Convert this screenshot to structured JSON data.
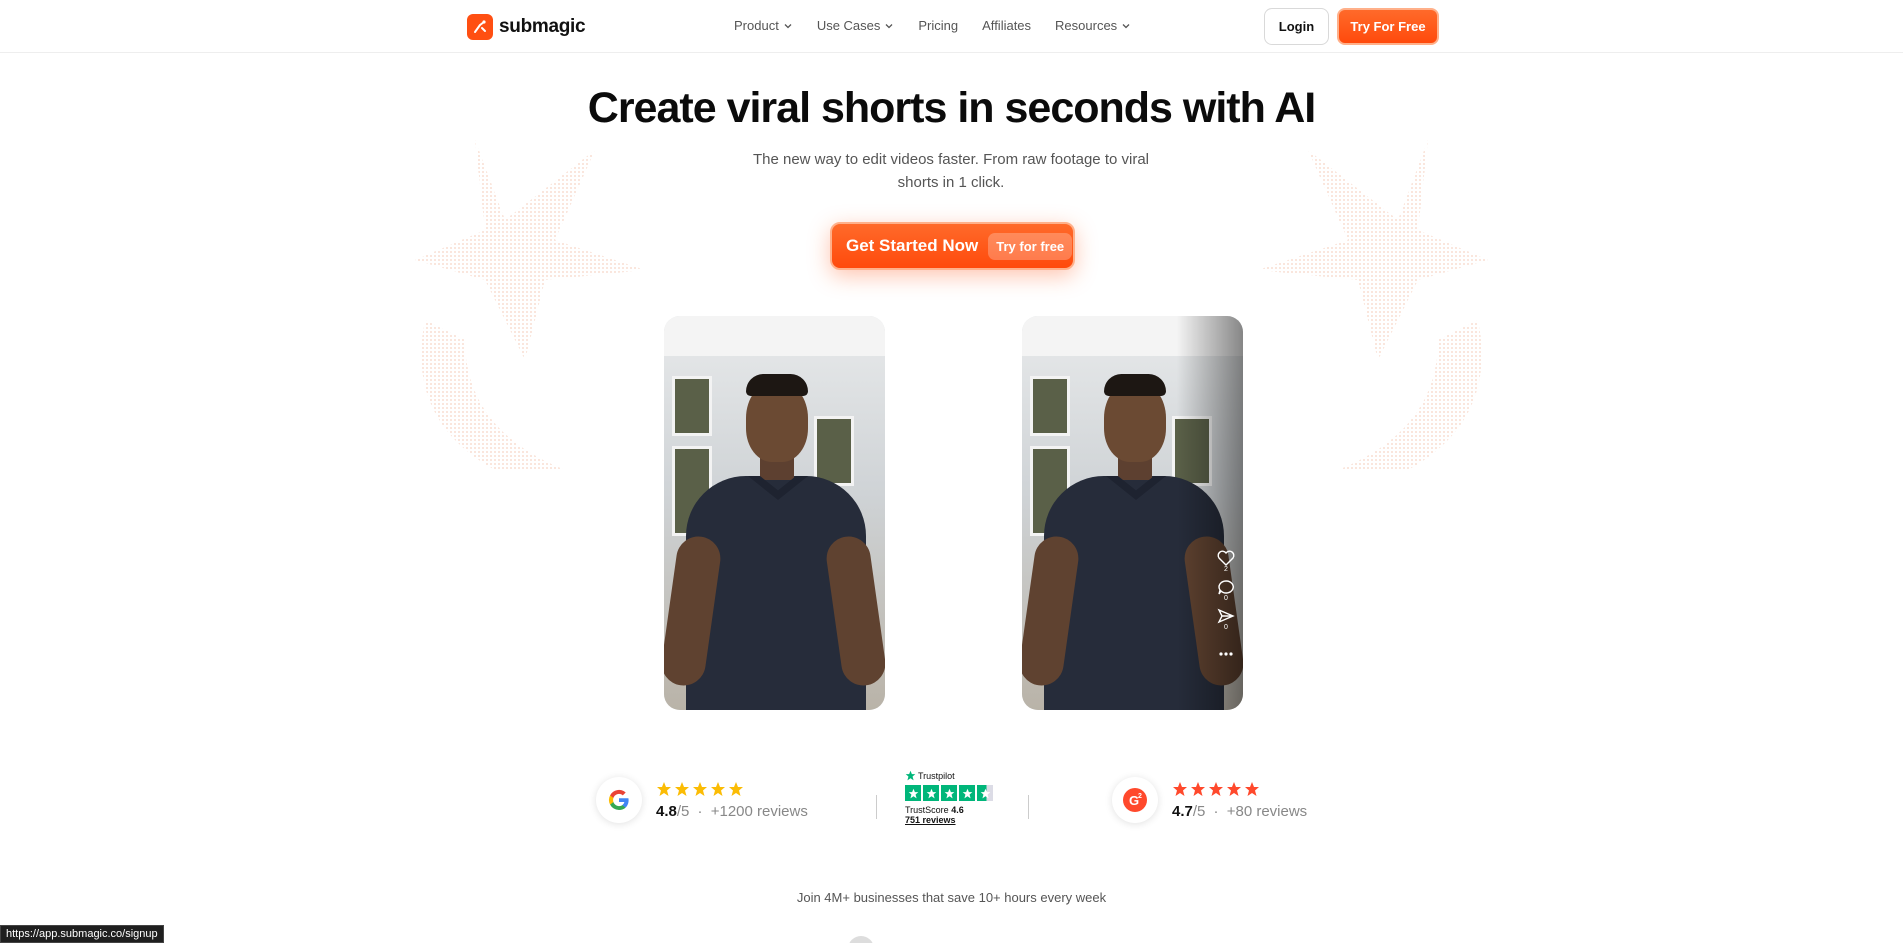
{
  "colors": {
    "brand": "#ff4f12",
    "google_star": "#fbbc04",
    "g2_star": "#ff492c",
    "trustpilot": "#00b67a"
  },
  "nav": {
    "logo_text": "submagic",
    "menu": [
      {
        "label": "Product",
        "has_dropdown": true
      },
      {
        "label": "Use Cases",
        "has_dropdown": true
      },
      {
        "label": "Pricing",
        "has_dropdown": false
      },
      {
        "label": "Affiliates",
        "has_dropdown": false
      },
      {
        "label": "Resources",
        "has_dropdown": true
      }
    ],
    "login_label": "Login",
    "try_label": "Try For Free"
  },
  "hero": {
    "title": "Create viral shorts in seconds with AI",
    "subtitle": "The new way to edit videos faster. From raw footage to viral shorts in 1 click.",
    "cta_label": "Get Started Now",
    "cta_pill": "Try for free"
  },
  "video_right": {
    "like_count": "2",
    "comment_count": "0",
    "share_count": "0"
  },
  "reviews": {
    "google": {
      "stars": 5,
      "score": "4.8",
      "out_of": "/5",
      "sep": "·",
      "reviews": "+1200 reviews"
    },
    "trustpilot": {
      "brand": "Trustpilot",
      "score_label": "TrustScore",
      "score": "4.6",
      "reviews": "751 reviews",
      "stars": 4.5
    },
    "g2": {
      "stars": 5,
      "score": "4.7",
      "out_of": "/5",
      "sep": "·",
      "reviews": "+80 reviews"
    }
  },
  "join_text": "Join 4M+ businesses that save 10+ hours every week",
  "status_url": "https://app.submagic.co/signup"
}
